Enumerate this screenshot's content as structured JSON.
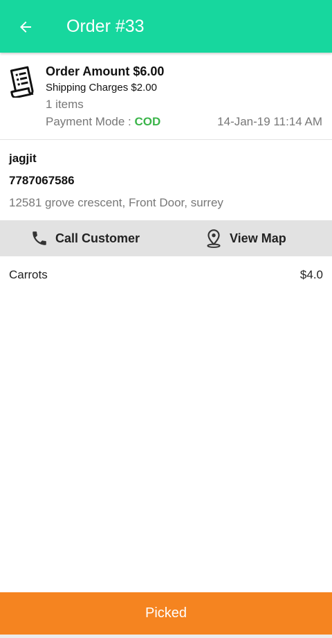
{
  "header": {
    "title": "Order #33",
    "back_icon": "arrow-left-icon",
    "color": "#17d79e"
  },
  "order": {
    "amount_label": "Order Amount $6.00",
    "shipping_label": "Shipping Charges $2.00",
    "items_label": "1 items",
    "payment_label": "Payment Mode : ",
    "payment_value": "COD",
    "date": "14-Jan-19 11:14 AM",
    "icon": "receipt-icon"
  },
  "customer": {
    "name": "jagjit",
    "phone": "7787067586",
    "address": "12581 grove crescent, Front Door, surrey"
  },
  "actions": {
    "call_label": "Call Customer",
    "call_icon": "phone-icon",
    "map_label": "View Map",
    "map_icon": "map-pin-icon"
  },
  "items": [
    {
      "name": "Carrots",
      "price": "$4.0"
    }
  ],
  "footer": {
    "picked_label": "Picked",
    "color": "#f58420"
  }
}
